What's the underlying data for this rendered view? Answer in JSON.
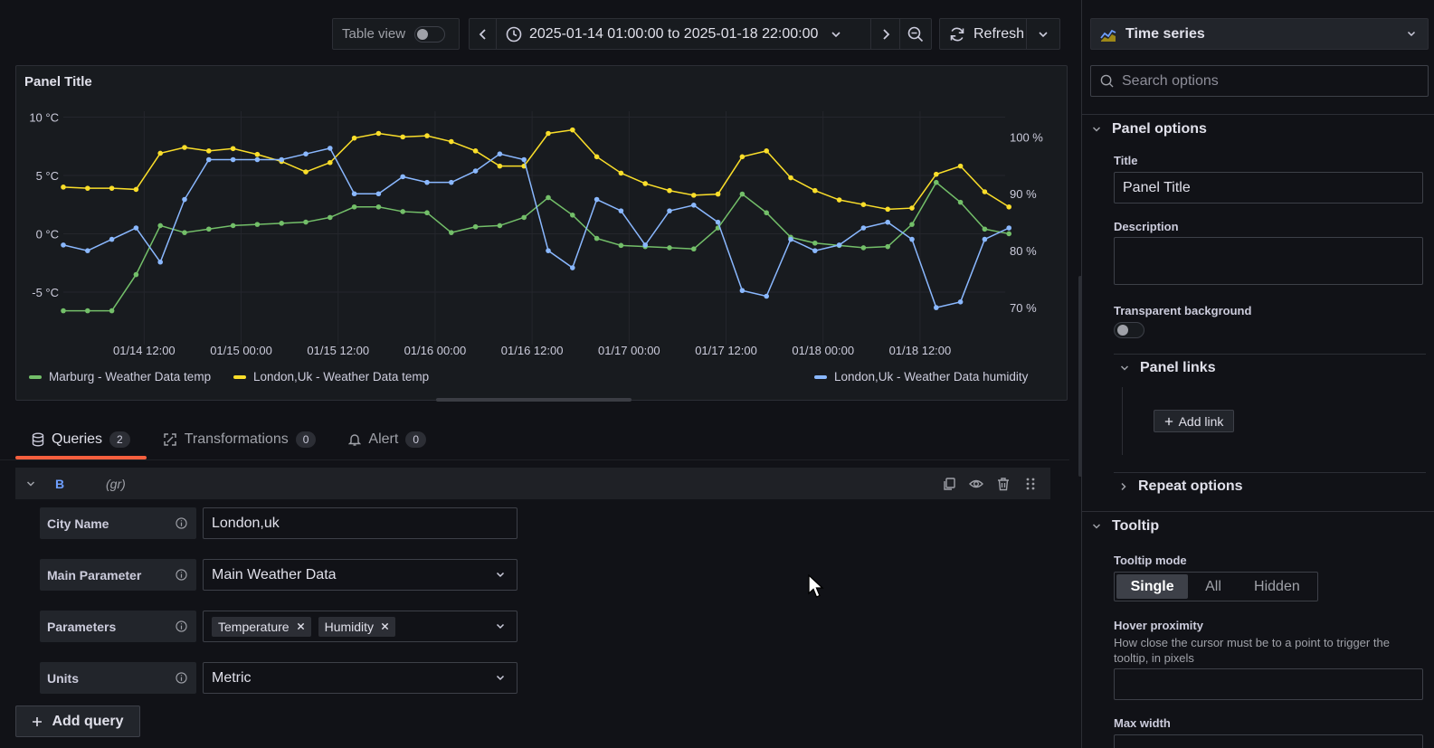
{
  "toolbar": {
    "table_view_label": "Table view",
    "time_range": "2025-01-14 01:00:00 to 2025-01-18 22:00:00",
    "refresh_label": "Refresh"
  },
  "panel": {
    "title": "Panel Title"
  },
  "chart_data": {
    "type": "line",
    "x": [
      "01/14 01:00",
      "01/14 04:00",
      "01/14 07:00",
      "01/14 10:00",
      "01/14 13:00",
      "01/14 16:00",
      "01/14 19:00",
      "01/14 22:00",
      "01/15 01:00",
      "01/15 04:00",
      "01/15 07:00",
      "01/15 10:00",
      "01/15 13:00",
      "01/15 16:00",
      "01/15 19:00",
      "01/15 22:00",
      "01/16 01:00",
      "01/16 04:00",
      "01/16 07:00",
      "01/16 10:00",
      "01/16 13:00",
      "01/16 16:00",
      "01/16 19:00",
      "01/16 22:00",
      "01/17 01:00",
      "01/17 04:00",
      "01/17 07:00",
      "01/17 10:00",
      "01/17 13:00",
      "01/17 16:00",
      "01/17 19:00",
      "01/17 22:00",
      "01/18 01:00",
      "01/18 04:00",
      "01/18 07:00",
      "01/18 10:00",
      "01/18 13:00",
      "01/18 16:00",
      "01/18 19:00",
      "01/18 22:00"
    ],
    "x_ticks": [
      "01/14 12:00",
      "01/15 00:00",
      "01/15 12:00",
      "01/16 00:00",
      "01/16 12:00",
      "01/17 00:00",
      "01/17 12:00",
      "01/18 00:00",
      "01/18 12:00"
    ],
    "y_left_ticks": [
      "10 °C",
      "5 °C",
      "0 °C",
      "-5 °C"
    ],
    "y_right_ticks": [
      "100 %",
      "90 %",
      "80 %",
      "70 %"
    ],
    "ylim_left": [
      -9.5,
      10.5
    ],
    "ylim_right": [
      63.5,
      104.5
    ],
    "grid": true,
    "legend_position": "bottom",
    "series": [
      {
        "name": "Marburg - Weather Data temp",
        "axis": "left",
        "color": "#73bf69",
        "values": [
          -6.6,
          -6.6,
          -6.6,
          -3.5,
          0.7,
          0.1,
          0.4,
          0.7,
          0.8,
          0.9,
          1.0,
          1.4,
          2.3,
          2.3,
          1.9,
          1.8,
          0.1,
          0.6,
          0.7,
          1.4,
          3.1,
          1.6,
          -0.4,
          -1.0,
          -1.1,
          -1.2,
          -1.3,
          0.5,
          3.4,
          1.8,
          -0.3,
          -0.8,
          -1.0,
          -1.2,
          -1.1,
          0.8,
          4.4,
          2.7,
          0.4,
          0.0
        ]
      },
      {
        "name": "London,Uk - Weather Data temp",
        "axis": "left",
        "color": "#fade2a",
        "values": [
          4.0,
          3.9,
          3.9,
          3.8,
          6.9,
          7.4,
          7.1,
          7.3,
          6.8,
          6.2,
          5.3,
          6.1,
          8.2,
          8.6,
          8.3,
          8.4,
          7.9,
          7.1,
          5.8,
          5.8,
          8.6,
          8.9,
          6.6,
          5.2,
          4.3,
          3.7,
          3.3,
          3.4,
          6.6,
          7.1,
          4.8,
          3.7,
          2.9,
          2.5,
          2.1,
          2.2,
          5.1,
          5.8,
          3.6,
          2.3
        ]
      },
      {
        "name": "London,Uk - Weather Data humidity",
        "axis": "right",
        "color": "#8ab8ff",
        "values": [
          81,
          80,
          82,
          84,
          78,
          89,
          96,
          96,
          96,
          96,
          97,
          98,
          90,
          90,
          93,
          92,
          92,
          94,
          97,
          96,
          80,
          77,
          89,
          87,
          81,
          87,
          88,
          85,
          73,
          72,
          82,
          80,
          81,
          84,
          85,
          82,
          70,
          71,
          82,
          84
        ]
      }
    ]
  },
  "tabs": [
    {
      "label": "Queries",
      "count": "2"
    },
    {
      "label": "Transformations",
      "count": "0"
    },
    {
      "label": "Alert",
      "count": "0"
    }
  ],
  "query": {
    "ref_id": "B",
    "datasource": "(gr)",
    "rows": [
      {
        "label": "City Name",
        "value": "London,uk"
      },
      {
        "label": "Main Parameter",
        "value": "Main Weather Data"
      },
      {
        "label": "Parameters",
        "chips": [
          "Temperature",
          "Humidity"
        ]
      },
      {
        "label": "Units",
        "value": "Metric"
      }
    ],
    "add_query_label": "Add query"
  },
  "options": {
    "viz_name": "Time series",
    "search_placeholder": "Search options",
    "panel_options_header": "Panel options",
    "title_label": "Title",
    "title_value": "Panel Title",
    "description_label": "Description",
    "transparent_label": "Transparent background",
    "panel_links_header": "Panel links",
    "add_link_label": "Add link",
    "repeat_options_header": "Repeat options",
    "tooltip_header": "Tooltip",
    "tooltip_mode_label": "Tooltip mode",
    "tooltip_modes": [
      "Single",
      "All",
      "Hidden"
    ],
    "hover_proximity_label": "Hover proximity",
    "hover_proximity_desc": "How close the cursor must be to a point to trigger the tooltip, in pixels",
    "max_width_label": "Max width"
  }
}
